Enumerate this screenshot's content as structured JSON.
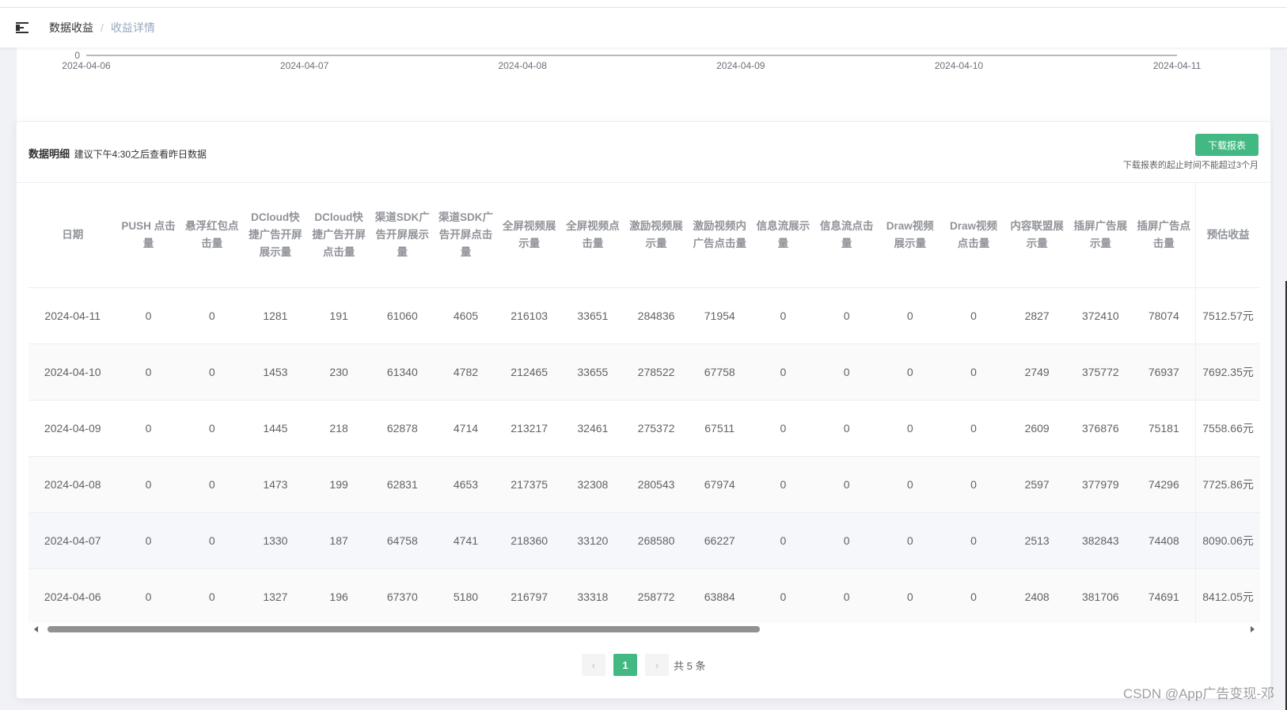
{
  "breadcrumb": {
    "home": "数据收益",
    "separator": "/",
    "current": "收益详情"
  },
  "chart_data": {
    "type": "line",
    "x": [
      "2024-04-06",
      "2024-04-07",
      "2024-04-08",
      "2024-04-09",
      "2024-04-10",
      "2024-04-11"
    ],
    "y_tick_visible": "0"
  },
  "card": {
    "title": "数据明细",
    "subtitle": "建议下午4:30之后查看昨日数据",
    "download_label": "下载报表",
    "download_tip": "下载报表的起止时间不能超过3个月"
  },
  "table": {
    "columns": [
      "日期",
      "PUSH 点击量",
      "悬浮红包点击量",
      "DCloud快捷广告开屏展示量",
      "DCloud快捷广告开屏点击量",
      "渠道SDK广告开屏展示量",
      "渠道SDK广告开屏点击量",
      "全屏视频展示量",
      "全屏视频点击量",
      "激励视频展示量",
      "激励视频内广告点击量",
      "信息流展示量",
      "信息流点击量",
      "Draw视频展示量",
      "Draw视频点击量",
      "内容联盟展示量",
      "插屏广告展示量",
      "插屏广告点击量",
      "预估收益"
    ],
    "rows": [
      [
        "2024-04-11",
        "0",
        "0",
        "1281",
        "191",
        "61060",
        "4605",
        "216103",
        "33651",
        "284836",
        "71954",
        "0",
        "0",
        "0",
        "0",
        "2827",
        "372410",
        "78074",
        "7512.57元"
      ],
      [
        "2024-04-10",
        "0",
        "0",
        "1453",
        "230",
        "61340",
        "4782",
        "212465",
        "33655",
        "278522",
        "67758",
        "0",
        "0",
        "0",
        "0",
        "2749",
        "375772",
        "76937",
        "7692.35元"
      ],
      [
        "2024-04-09",
        "0",
        "0",
        "1445",
        "218",
        "62878",
        "4714",
        "213217",
        "32461",
        "275372",
        "67511",
        "0",
        "0",
        "0",
        "0",
        "2609",
        "376876",
        "75181",
        "7558.66元"
      ],
      [
        "2024-04-08",
        "0",
        "0",
        "1473",
        "199",
        "62831",
        "4653",
        "217375",
        "32308",
        "280543",
        "67974",
        "0",
        "0",
        "0",
        "0",
        "2597",
        "377979",
        "74296",
        "7725.86元"
      ],
      [
        "2024-04-07",
        "0",
        "0",
        "1330",
        "187",
        "64758",
        "4741",
        "218360",
        "33120",
        "268580",
        "66227",
        "0",
        "0",
        "0",
        "0",
        "2513",
        "382843",
        "74408",
        "8090.06元"
      ],
      [
        "2024-04-06",
        "0",
        "0",
        "1327",
        "196",
        "67370",
        "5180",
        "216797",
        "33318",
        "258772",
        "63884",
        "0",
        "0",
        "0",
        "0",
        "2408",
        "381706",
        "74691",
        "8412.05元"
      ]
    ]
  },
  "pagination": {
    "current": "1",
    "total_text": "共 5 条"
  },
  "watermark": "CSDN @App广告变现-邓"
}
